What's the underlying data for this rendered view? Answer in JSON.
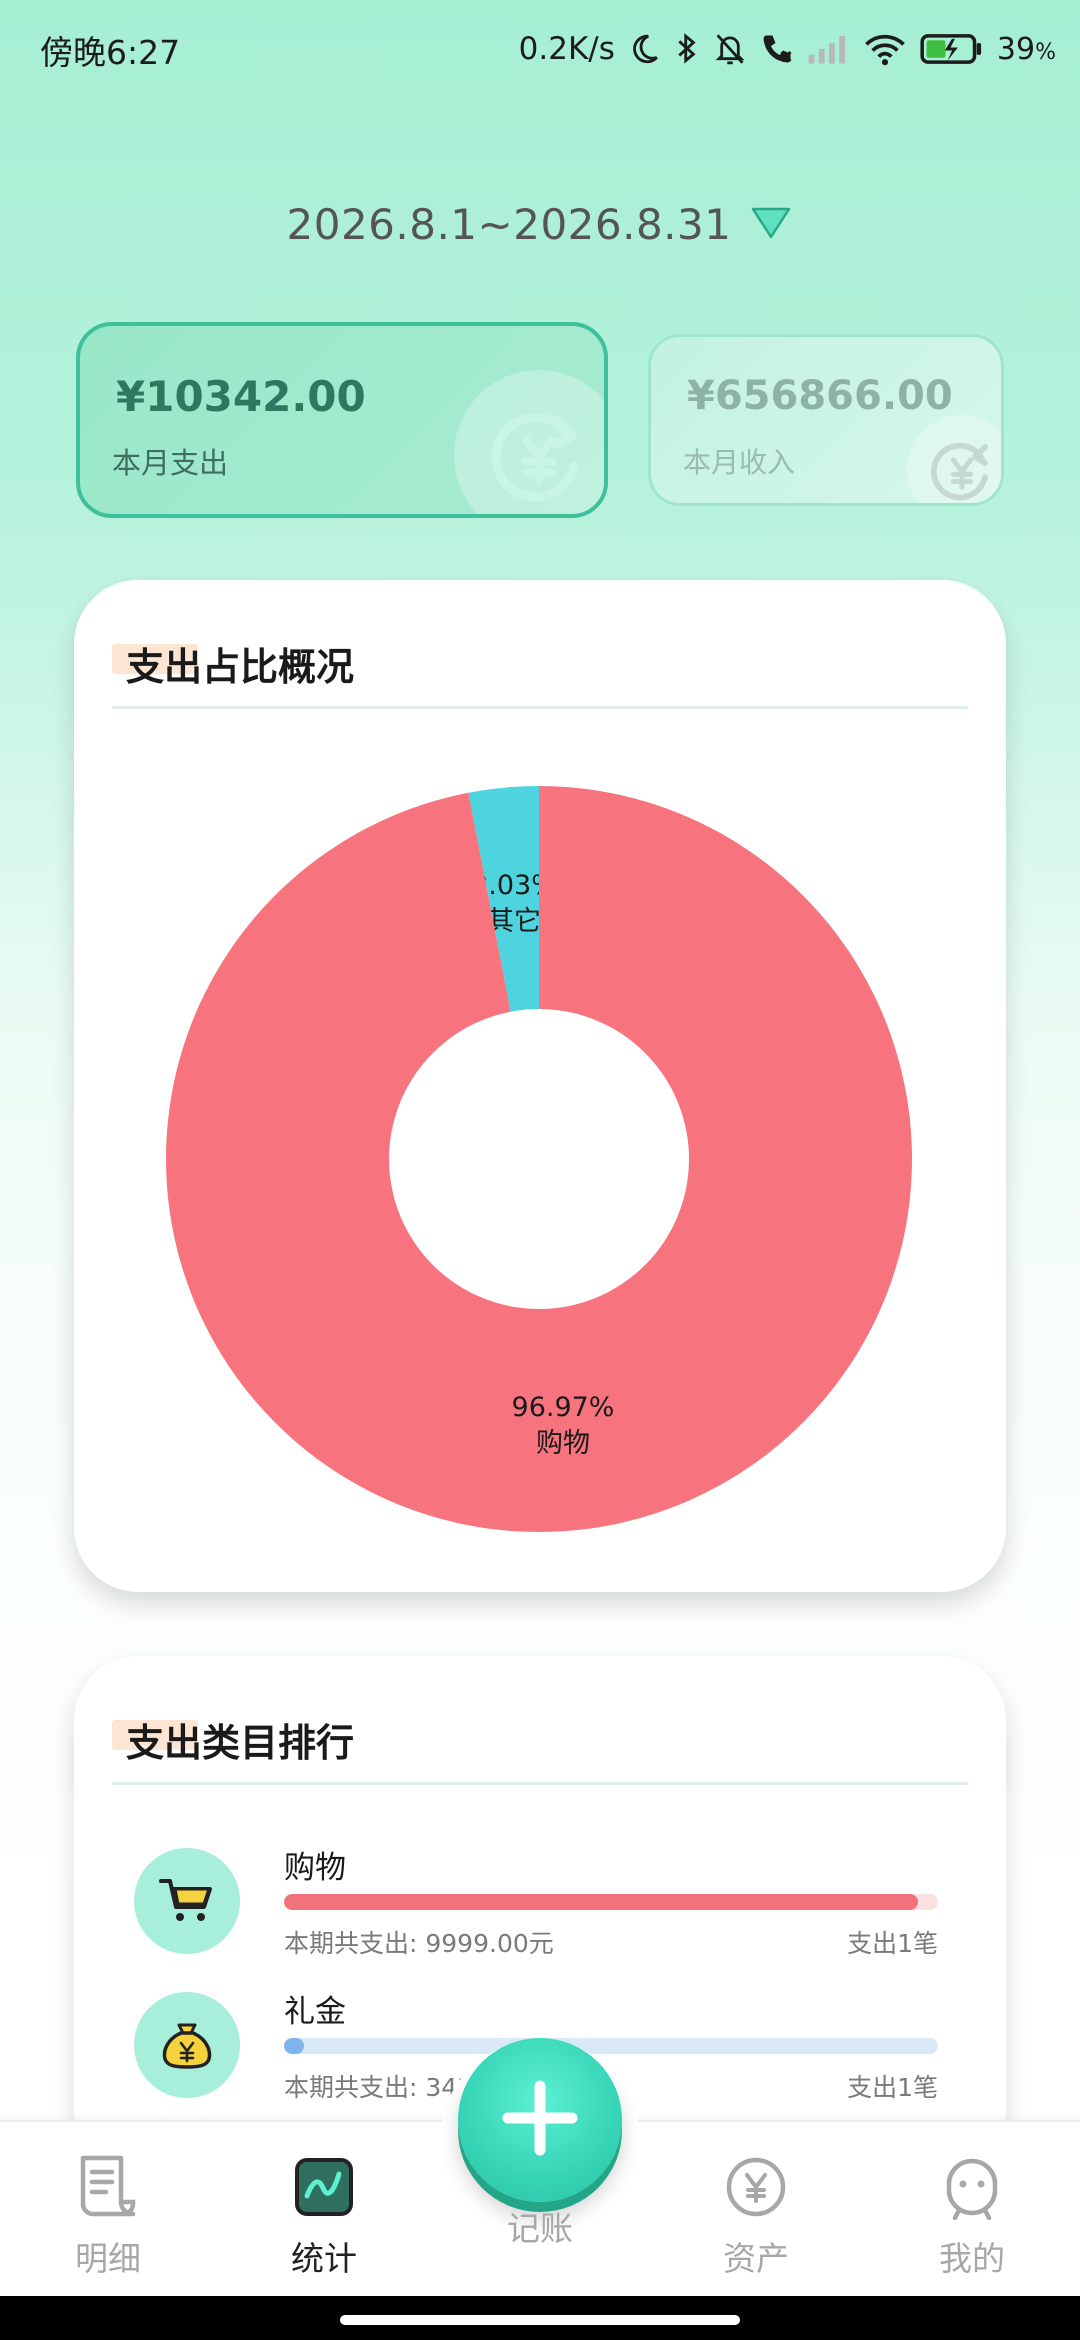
{
  "status_bar": {
    "time": "傍晚6:27",
    "net_speed": "0.2K/s",
    "battery_pct": "39",
    "battery_unit": "%",
    "icons": [
      "moon-icon",
      "bluetooth-icon",
      "mute-icon",
      "call-icon",
      "signal-icon",
      "wifi-icon",
      "battery-icon"
    ]
  },
  "header": {
    "date_range": "2026.8.1~2026.8.31"
  },
  "summary": {
    "expense": {
      "amount": "¥10342.00",
      "label": "本月支出"
    },
    "income": {
      "amount": "¥656866.00",
      "label": "本月收入"
    }
  },
  "pie_panel": {
    "title": "支出占比概况"
  },
  "chart_data": {
    "type": "pie",
    "donut": true,
    "slices": [
      {
        "label": "购物",
        "percent": 96.97,
        "percent_text": "96.97%",
        "color": "#f7737e"
      },
      {
        "label": "其它",
        "percent": 3.03,
        "percent_text": "3.03%",
        "color": "#4dd4de"
      }
    ]
  },
  "rank_panel": {
    "title": "支出类目排行",
    "items": [
      {
        "name": "购物",
        "total": "本期共支出: 9999.00元",
        "count": "支出1笔",
        "ratio": 0.9697,
        "icon": "shopping-cart-icon"
      },
      {
        "name": "礼金",
        "total": "本期共支出: 343.00元",
        "count": "支出1笔",
        "ratio": 0.0303,
        "icon": "money-bag-icon"
      }
    ]
  },
  "tab_bar": {
    "tabs": [
      {
        "label": "明细",
        "icon": "document-icon"
      },
      {
        "label": "统计",
        "icon": "chart-icon"
      },
      {
        "label": "记账",
        "icon": "plus-icon"
      },
      {
        "label": "资产",
        "icon": "yuan-coin-icon"
      },
      {
        "label": "我的",
        "icon": "user-icon"
      }
    ]
  }
}
